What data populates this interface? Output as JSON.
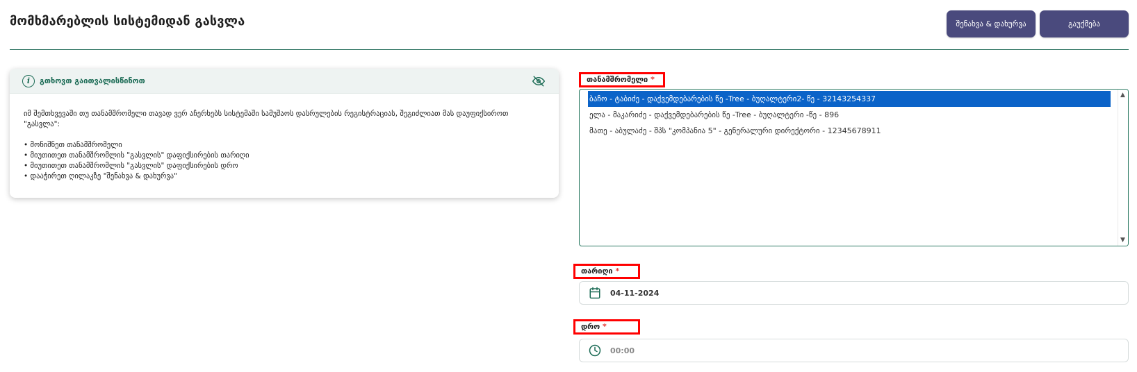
{
  "page": {
    "title": "მომხმარებლის სისტემიდან გასვლა"
  },
  "toolbar": {
    "save_label": "შენახვა & დახურვა",
    "cancel_label": "გაუქმება"
  },
  "info": {
    "title": "გთხოვთ გაითვალისწინოთ",
    "paragraph": "იმ შემთხვევაში თუ თანამშრომელი თავად ვერ აჩერხებს სისტემაში სამუშაოს დასრულების რეგისტრაციას, შეგიძლიათ მას დაუფიქსიროთ \"გასვლა\":",
    "bullets": [
      "მონიშნეთ თანამშრომელი",
      "მიუთითეთ თანამშრომლის \"გასვლის\" დაფიქსირების თარიღი",
      "მიუთითეთ თანამშრომლის \"გასვლის\" დაფიქსირების დრო",
      "დააჭირეთ ღილაკზე \"შენახვა & დახურვა\""
    ]
  },
  "form": {
    "employee_label": "თანამშრომელი",
    "required_mark": "*",
    "employees": [
      "ბაჩო - ტაბიძე - დაქვემდებარების წე -Tree - ბუღალტერი2- წე - 32143254337",
      "ელა - მაკარიძე - დაქვემდებარების წე -Tree - ბუღალტერი -წე - 896",
      "მათე - აბულაძე - შპს \"კომპანია 5\" - გენერალური დირექტორი - 12345678911"
    ],
    "selected_index": 0,
    "date_label": "თარიღი",
    "date_value": "04-11-2024",
    "time_label": "დრო",
    "time_placeholder": "00:00"
  },
  "icons": {
    "info": "info-icon",
    "hide": "eye-off-icon",
    "calendar": "calendar-icon",
    "clock": "clock-icon"
  },
  "colors": {
    "accent": "#1b6b55",
    "button": "#4a4a7d",
    "selection": "#0b63c8",
    "required": "#e53935",
    "highlight": "#ff0000"
  }
}
